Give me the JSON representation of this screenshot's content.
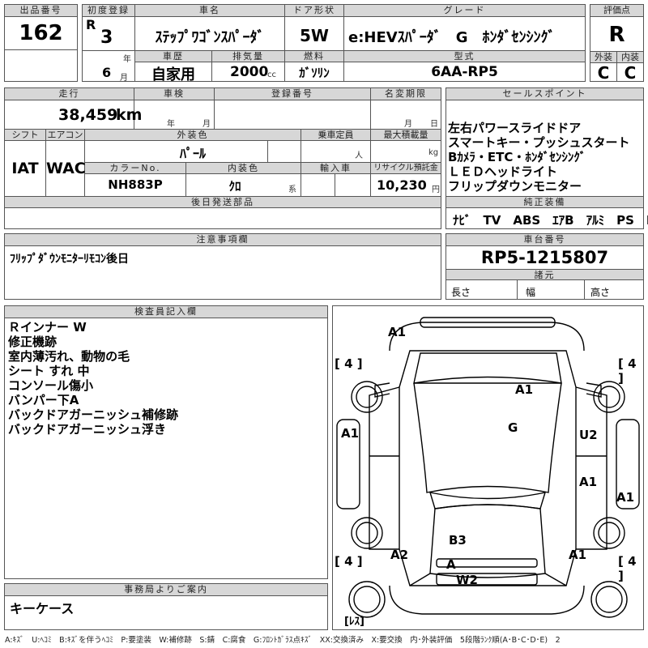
{
  "header": {
    "lot_no_label": "出品番号",
    "lot_no": "162",
    "first_reg_label": "初度登録",
    "era": "R",
    "year": "3",
    "year_unit": "年",
    "month": "6",
    "month_unit": "月",
    "car_name_label": "車名",
    "car_name": "ｽﾃｯﾌﾟﾜｺﾞﾝｽﾊﾟｰﾀﾞ",
    "door_label": "ドア形状",
    "door": "5W",
    "grade_label": "グレード",
    "grade": "e:HEVｽﾊﾟｰﾀﾞ　G　ﾎﾝﾀﾞｾﾝｼﾝｸﾞ",
    "score_label": "評価点",
    "score": "R",
    "history_label": "車歴",
    "history": "自家用",
    "displacement_label": "排気量",
    "displacement": "2000",
    "displacement_unit": "cc",
    "fuel_label": "燃料",
    "fuel": "ｶﾞｿﾘﾝ",
    "model_label": "型式",
    "model": "6AA-RP5",
    "exterior_label": "外装",
    "exterior": "C",
    "interior_label": "内装",
    "interior": "C"
  },
  "mid": {
    "mileage_label": "走行",
    "mileage": "38,459",
    "mileage_unit": "km",
    "inspection_label": "車検",
    "insp_year_unit": "年",
    "insp_month_unit": "月",
    "reg_no_label": "登録番号",
    "name_change_label": "名変期限",
    "nc_month_unit": "月",
    "nc_day_unit": "日",
    "shift_label": "シフト",
    "shift": "IAT",
    "ac_label": "エアコン",
    "ac": "WAC",
    "ext_color_label": "外装色",
    "ext_color": "ﾊﾟｰﾙ",
    "capacity_label": "乗車定員",
    "capacity_unit": "人",
    "max_load_label": "最大積載量",
    "max_load_unit": "kg",
    "color_no_label": "カラーNo.",
    "color_no": "NH883P",
    "int_color_label": "内装色",
    "int_color": "ｸﾛ",
    "int_color_unit": "系",
    "import_label": "輸入車",
    "recycle_label": "リサイクル預託金",
    "recycle": "10,230",
    "recycle_unit": "円",
    "later_parts_label": "後日発送部品",
    "sales_label": "セールスポイント",
    "sales_points": [
      "左右パワースライドドア",
      "スマートキー・プッシュスタート",
      "Bｶﾒﾗ・ETC・ﾎﾝﾀﾞｾﾝｼﾝｸﾞ",
      "ＬＥＤヘッドライト",
      "フリップダウンモニター"
    ],
    "equip_label": "純正装備",
    "equipment": "ﾅﾋﾞ　TV　ABS　ｴｱB　ｱﾙﾐ　PS　PW",
    "notes_label": "注意事項欄",
    "notes": "ﾌﾘｯﾌﾟﾀﾞｳﾝﾓﾆﾀｰﾘﾓｺﾝ後日",
    "chassis_label": "車台番号",
    "chassis": "RP5-1215807",
    "specs_label": "諸元",
    "length_label": "長さ",
    "width_label": "幅",
    "height_label": "高さ"
  },
  "inspector": {
    "label": "検査員記入欄",
    "lines": [
      "Ｒインナー W",
      "修正機跡",
      "室内薄汚れ、動物の毛",
      "シート すれ 中",
      "コンソール傷小",
      "バンパー下A",
      "バックドアガーニッシュ補修跡",
      "バックドアガーニッシュ浮き"
    ]
  },
  "office": {
    "label": "事務局よりご案内",
    "text": "キーケース"
  },
  "diagram": {
    "tires": [
      "[ 4 ]",
      "[ 4 ]",
      "[ 4 ]",
      "[ 4 ]",
      "[ﾚｽ]"
    ],
    "marks": [
      "A1",
      "A1",
      "A1",
      "G",
      "U2",
      "A1",
      "A1",
      "B3",
      "A2",
      "A",
      "A1",
      "W2"
    ]
  },
  "legend": "A:ｷｽﾞ　U:ﾍｺﾐ　B:ｷｽﾞを伴うﾍｺﾐ　P:要塗装　W:補修跡　S:錆　C:腐食　G:ﾌﾛﾝﾄｶﾞﾗｽ点ｷｽﾞ　XX:交換済み　X:要交換　内･外装評価　5段階ﾗﾝｸ順(A･B･C･D･E)　2"
}
